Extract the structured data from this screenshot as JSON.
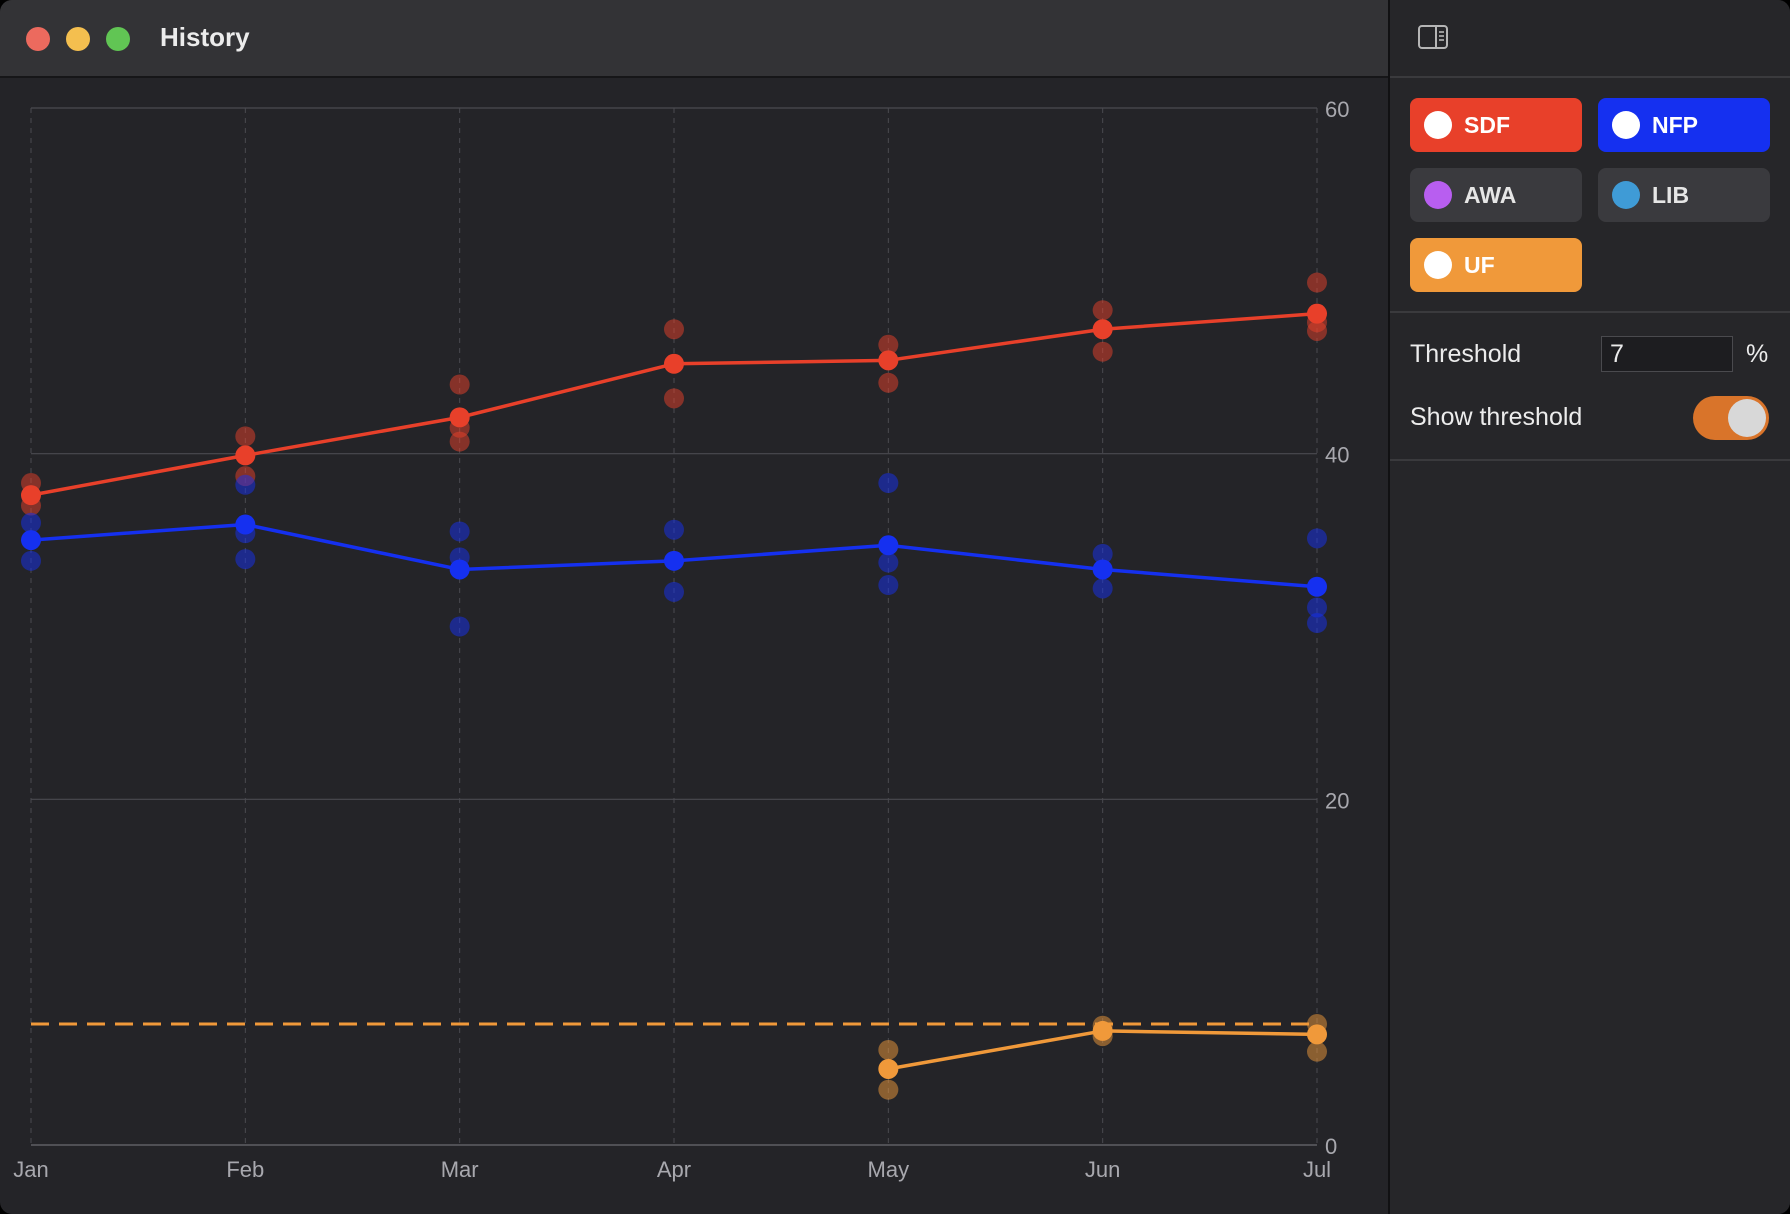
{
  "window": {
    "title": "History"
  },
  "sidebar": {
    "toggle_icon": "sidebar-right-icon",
    "parties": [
      {
        "label": "SDF",
        "color": "#e8402a",
        "selected": true
      },
      {
        "label": "NFP",
        "color": "#1530f0",
        "selected": true
      },
      {
        "label": "AWA",
        "color": "#b85ef0",
        "selected": false
      },
      {
        "label": "LIB",
        "color": "#3f9bd6",
        "selected": false
      },
      {
        "label": "UF",
        "color": "#f0993a",
        "selected": true
      }
    ],
    "threshold_label": "Threshold",
    "threshold_value": "7",
    "threshold_unit": "%",
    "show_threshold_label": "Show threshold",
    "show_threshold": true
  },
  "chart_data": {
    "type": "line",
    "categories": [
      "Jan",
      "Feb",
      "Mar",
      "Apr",
      "May",
      "Jun",
      "Jul"
    ],
    "ylim": [
      0,
      60
    ],
    "yticks": [
      "0",
      "20",
      "40",
      "60"
    ],
    "threshold": 7,
    "series": [
      {
        "name": "SDF",
        "color": "#e8402a",
        "values": [
          37.6,
          39.9,
          42.1,
          45.2,
          45.4,
          47.2,
          48.1
        ],
        "polls": [
          [
            38.3,
            37.0
          ],
          [
            41.0,
            38.7
          ],
          [
            44.0,
            41.5,
            40.7
          ],
          [
            47.2,
            43.2
          ],
          [
            46.3,
            44.1
          ],
          [
            48.3,
            45.9
          ],
          [
            49.9,
            47.6,
            47.1
          ]
        ]
      },
      {
        "name": "NFP",
        "color": "#1530f0",
        "values": [
          35.0,
          35.9,
          33.3,
          33.8,
          34.7,
          33.3,
          32.3
        ],
        "polls": [
          [
            36.0,
            33.8
          ],
          [
            38.2,
            35.4,
            33.9
          ],
          [
            35.5,
            34.0,
            30.0
          ],
          [
            35.6,
            32.0
          ],
          [
            38.3,
            33.7,
            32.4
          ],
          [
            34.2,
            32.2
          ],
          [
            35.1,
            31.1,
            30.2
          ]
        ]
      },
      {
        "name": "UF",
        "color": "#f0993a",
        "values": [
          null,
          null,
          null,
          null,
          4.4,
          6.6,
          6.4
        ],
        "polls": [
          [],
          [],
          [],
          [],
          [
            5.5,
            3.2
          ],
          [
            6.9,
            6.3
          ],
          [
            7.0,
            5.4
          ]
        ]
      }
    ]
  }
}
